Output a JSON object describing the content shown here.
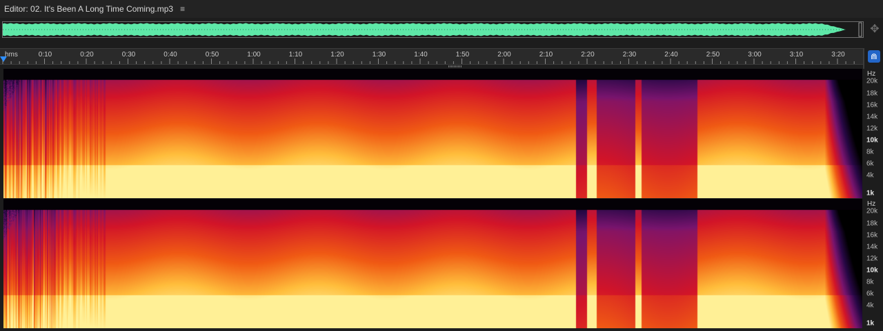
{
  "editor": {
    "title": "Editor: 02. It's Been A Long Time Coming.mp3",
    "menu_icon": "hamburger-menu-icon",
    "menu_glyph": "≡"
  },
  "overview": {
    "waveform_color": "#5ee8a8",
    "zoom_icon": "zoom-navigator-icon"
  },
  "ruler": {
    "unit": "hms",
    "labels": [
      "0:10",
      "0:20",
      "0:30",
      "0:40",
      "0:50",
      "1:00",
      "1:10",
      "1:20",
      "1:30",
      "1:40",
      "1:50",
      "2:00",
      "2:10",
      "2:20",
      "2:30",
      "2:40",
      "2:50",
      "3:00",
      "3:10",
      "3:20"
    ],
    "snap_icon": "magnet-snap-icon"
  },
  "frequency_scale": {
    "unit": "Hz",
    "ticks": [
      {
        "label": "20k",
        "major": false
      },
      {
        "label": "18k",
        "major": false
      },
      {
        "label": "16k",
        "major": false
      },
      {
        "label": "14k",
        "major": false
      },
      {
        "label": "12k",
        "major": false
      },
      {
        "label": "10k",
        "major": true
      },
      {
        "label": "8k",
        "major": false
      },
      {
        "label": "6k",
        "major": false
      },
      {
        "label": "4k",
        "major": false
      },
      {
        "label": "1k",
        "major": true
      }
    ]
  },
  "colors": {
    "background": "#1d1d1d",
    "spectrogram_low": "#000000",
    "spectrogram_mid": "#c01a1a",
    "spectrogram_high": "#ffe27a",
    "accent": "#2f8fff"
  }
}
